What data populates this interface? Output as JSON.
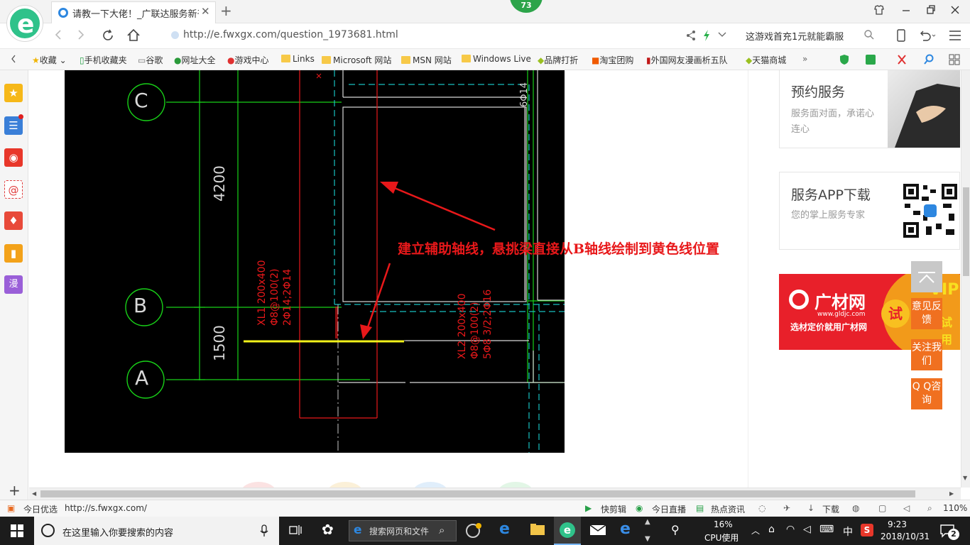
{
  "browser": {
    "tab_title": "请教一下大佬！_广联达服务新干线",
    "tab_close": "✕",
    "new_tab": "+",
    "badge": "73",
    "url": "http://e.fwxgx.com/question_1973681.html",
    "promo": "这游戏首充1元就能霸服"
  },
  "bookmarks": [
    {
      "label": "收藏",
      "type": "star"
    },
    {
      "label": "手机收藏夹",
      "type": "phone"
    },
    {
      "label": "谷歌",
      "type": "page"
    },
    {
      "label": "网址大全",
      "type": "web"
    },
    {
      "label": "游戏中心",
      "type": "game"
    },
    {
      "label": "Links",
      "type": "folder"
    },
    {
      "label": "Microsoft 网站",
      "type": "folder"
    },
    {
      "label": "MSN 网站",
      "type": "folder"
    },
    {
      "label": "Windows Live",
      "type": "folder"
    },
    {
      "label": "品牌打折",
      "type": "leaf"
    },
    {
      "label": "淘宝团购",
      "type": "taobao"
    },
    {
      "label": "外国网友漫画析五队",
      "type": "bookmark"
    },
    {
      "label": "天猫商城",
      "type": "leaf"
    }
  ],
  "cad": {
    "axis_c": "C",
    "axis_b": "B",
    "axis_a": "A",
    "dim_4200": "4200",
    "dim_1500": "1500",
    "xl1": "XL1 200x400",
    "xl1_stirrup": "Φ8@100(2)",
    "xl1_bars": "2Φ14;2Φ14",
    "xl2": "XL2 200x400",
    "xl2_stirrup": "Φ8@100(2)",
    "xl2_bars": "5Φ8 3/2;2Φ16",
    "top_right_label": "6Φ14",
    "annotation": "建立辅助轴线，悬挑梁直接从B轴线绘制到黄色线位置",
    "colors": {
      "green": "#18d018",
      "red": "#e8181a",
      "cyan": "#18c0c0",
      "yellow": "#f2f21a",
      "white": "#d8d8d8"
    }
  },
  "right_panel": {
    "booking_title": "预约服务",
    "booking_desc": "服务面对面，承诺心连心",
    "app_title": "服务APP下载",
    "app_desc": "您的掌上服务专家",
    "ad_brand": "广材网",
    "ad_site": "www.gldjc.com",
    "ad_slogan": "选材定价就用广材网",
    "ad_try": "试",
    "ad_vip": "VIP",
    "ad_use": "试用",
    "feedback": "意见反馈",
    "follow": "关注我们",
    "qq": "Q Q咨询"
  },
  "statusbar": {
    "today": "今日优选",
    "hover_url": "http://s.fwxgx.com/",
    "quickcut": "快剪辑",
    "live": "今日直播",
    "news": "热点资讯",
    "download": "下载",
    "zoom": "110%"
  },
  "taskbar": {
    "search_placeholder": "在这里输入你要搜索的内容",
    "browser_search": "搜索网页和文件",
    "cpu_value": "16%",
    "cpu_label": "CPU使用",
    "ime": "中",
    "time": "9:23",
    "date": "2018/10/31",
    "notifications": "2"
  }
}
